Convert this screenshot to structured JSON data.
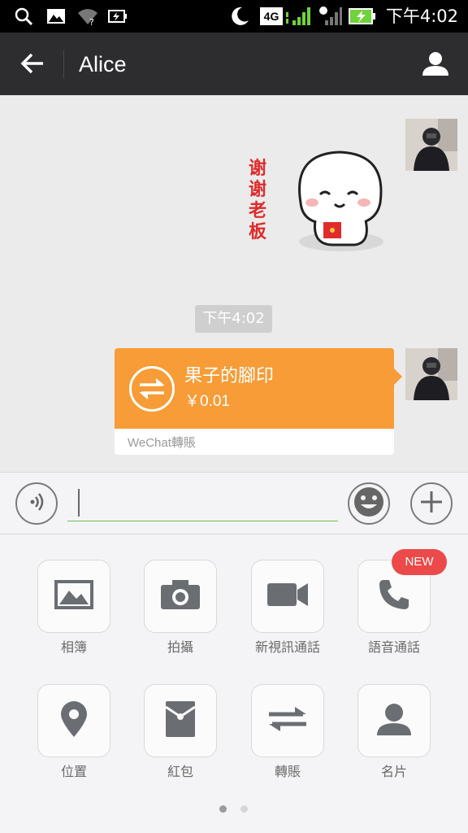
{
  "status_bar": {
    "time": "下午4:02",
    "network_label": "4G",
    "icons": [
      "search-icon",
      "image-icon",
      "wifi-icon",
      "battery-saver-icon",
      "moon-icon",
      "signal-icon",
      "battery-charging-icon"
    ]
  },
  "header": {
    "title": "Alice",
    "back_icon": "arrow-left-icon",
    "profile_icon": "person-icon"
  },
  "chat": {
    "sticker_text": "谢谢老板",
    "time_label": "下午4:02",
    "transfer": {
      "name": "果子的腳印",
      "amount": "￥0.01",
      "caption": "WeChat轉賬",
      "icon": "transfer-arrows-icon",
      "color": "#f79c36"
    }
  },
  "input_bar": {
    "voice_icon": "voice-icon",
    "emoji_icon": "emoji-icon",
    "plus_icon": "plus-icon",
    "text_value": ""
  },
  "panel": {
    "items": [
      {
        "label": "相簿",
        "icon": "photo-album-icon"
      },
      {
        "label": "拍攝",
        "icon": "camera-icon"
      },
      {
        "label": "新視訊通話",
        "icon": "video-call-icon"
      },
      {
        "label": "語音通話",
        "icon": "phone-icon"
      },
      {
        "label": "位置",
        "icon": "location-pin-icon"
      },
      {
        "label": "紅包",
        "icon": "red-packet-icon"
      },
      {
        "label": "轉賬",
        "icon": "transfer-icon"
      },
      {
        "label": "名片",
        "icon": "contact-card-icon"
      }
    ],
    "new_badge": "NEW",
    "page_count": 2,
    "active_page": 1
  },
  "colors": {
    "accent_orange": "#f79c36",
    "badge_red": "#ec4a4a",
    "input_underline": "#6cbf4d",
    "header_bg": "#2d2d30"
  }
}
